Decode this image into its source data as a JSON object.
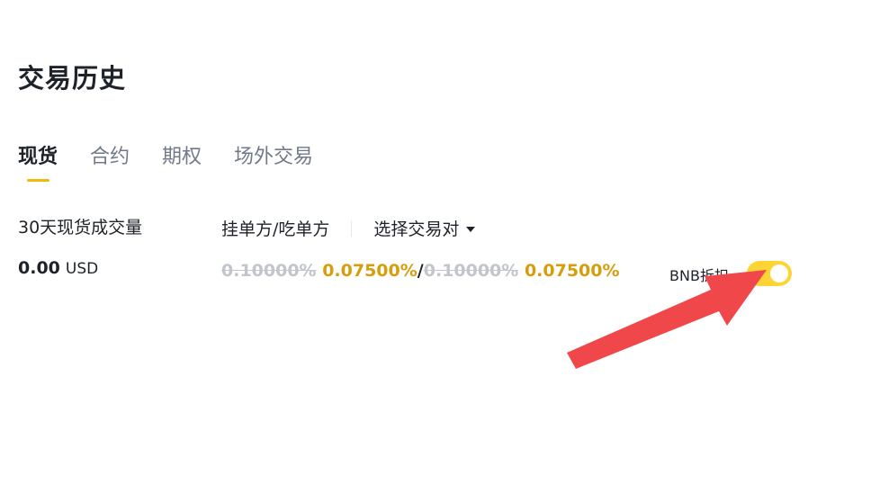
{
  "page": {
    "title": "交易历史"
  },
  "tabs": [
    {
      "label": "现货",
      "active": true
    },
    {
      "label": "合约",
      "active": false
    },
    {
      "label": "期权",
      "active": false
    },
    {
      "label": "场外交易",
      "active": false
    }
  ],
  "volume": {
    "label": "30天现货成交量",
    "value": "0.00",
    "unit": "USD"
  },
  "fees": {
    "header": "挂单方/吃单方",
    "pair_select": "选择交易对",
    "maker_original": "0.10000%",
    "maker_discounted": "0.07500%",
    "separator": "/",
    "taker_original": "0.10000%",
    "taker_discounted": "0.07500%"
  },
  "bnb_discount": {
    "label": "BNB折扣",
    "enabled": true
  },
  "colors": {
    "accent": "#f0b90b",
    "toggle_on": "#fcd535",
    "discount": "#d69e0c",
    "arrow": "#f0484a"
  }
}
